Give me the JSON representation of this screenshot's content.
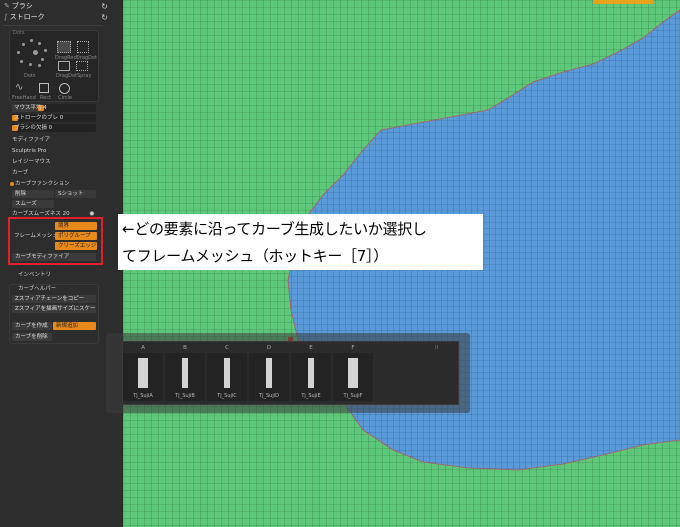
{
  "panel": {
    "brush_header": "ブラシ",
    "stroke_header": "ストローク",
    "brush_types": {
      "tab": "Dots",
      "dots": "Dots",
      "drag_rect": "DragRect",
      "dragdot": "DragDot",
      "spray": "Spray",
      "freehand": "FreeHand",
      "rect": "Rect",
      "circle": "Circle"
    },
    "rows": {
      "mouse_avg": "マウス平均 4",
      "stroke_shake": "ストロークのブレ 0",
      "brush_missing": "ブラシの欠損 0",
      "modifier": "モディファイア",
      "sculptris": "Sculptris Pro",
      "lazy_mouse": "レイジーマウス",
      "curve": "カーブ",
      "curve_functions": "カーブファンクション",
      "delete": "削除",
      "snapshot": "Sショット",
      "smooth": "スムーズ",
      "curve_smoothness": "カーブスムーズネス 20",
      "frame_mesh": "フレームメッシュ",
      "border": "境界",
      "polygroup": "ポリグループ",
      "crease_edge": "クリーズエッジ",
      "curve_modifier": "カーブモディファイア",
      "inventory": "インベントリ",
      "curve_helper": "カーブヘルパー",
      "zsphere_copy": "Zスフィアチェーンをコピー",
      "zsphere_scale": "Zスフィアを描画サイズにスケー",
      "create_curve": "カーブを作成",
      "new_add": "新規追加",
      "delete_curve": "カーブを削除"
    }
  },
  "annotation": {
    "line1": "←どの要素に沿ってカーブ生成したいか選択し",
    "line2": "てフレームメッシュ（ホットキー［7］）"
  },
  "palette": {
    "letters": [
      "A",
      "B",
      "C",
      "D",
      "E",
      "F"
    ],
    "extra": "II",
    "items": [
      "Tj_SujiA",
      "Tj_SujiB",
      "Tj_SujiC",
      "Tj_SujiD",
      "Tj_SujiE",
      "Tj_SujiF"
    ]
  },
  "colors": {
    "accent": "#e88a1b",
    "highlight_box": "#e0202a",
    "mesh_green": "#5dc77a",
    "mesh_blue": "#5a9ad8"
  }
}
